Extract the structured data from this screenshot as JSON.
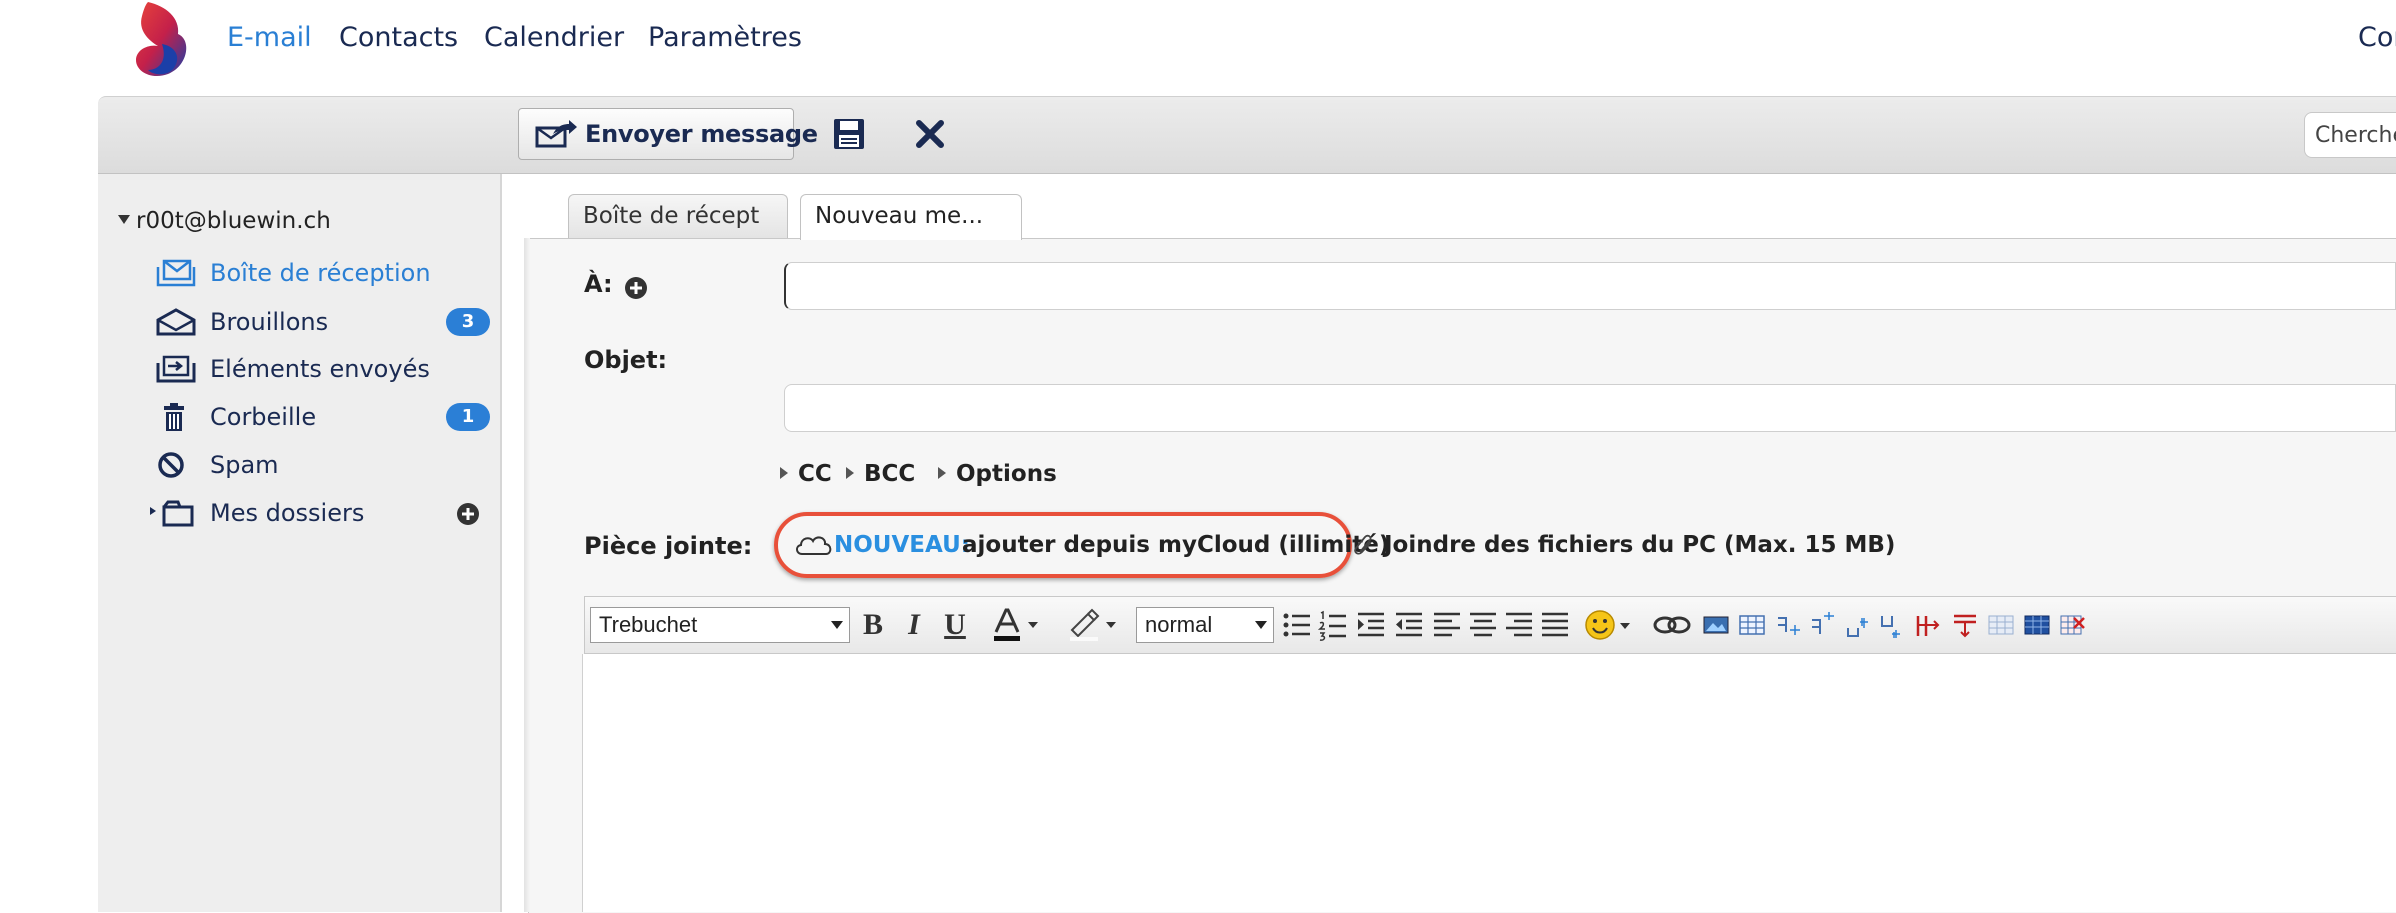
{
  "nav": {
    "email": "E-mail",
    "contacts": "Contacts",
    "calendar": "Calendrier",
    "settings": "Paramètres",
    "right_text": "Cor"
  },
  "toolbar": {
    "send_label": "Envoyer message",
    "search_placeholder": "Cherche"
  },
  "sidebar": {
    "account": "r00t@bluewin.ch",
    "folders": [
      {
        "label": "Boîte de réception",
        "icon": "inbox-icon",
        "active": true
      },
      {
        "label": "Brouillons",
        "icon": "drafts-icon",
        "count": "3"
      },
      {
        "label": "Eléments envoyés",
        "icon": "sent-icon"
      },
      {
        "label": "Corbeille",
        "icon": "trash-icon",
        "count": "1"
      },
      {
        "label": "Spam",
        "icon": "spam-icon"
      },
      {
        "label": "Mes dossiers",
        "icon": "folder-icon"
      }
    ]
  },
  "tabs": [
    {
      "label": "Boîte de récept"
    },
    {
      "label": "Nouveau me..."
    }
  ],
  "compose": {
    "to_label": "À:",
    "subject_label": "Objet:",
    "to_value": "",
    "subject_value": "",
    "cc_label": "CC",
    "bcc_label": "BCC",
    "options_label": "Options",
    "attachment_label": "Pièce jointe:",
    "mycloud_new": "NOUVEAU:",
    "mycloud_text": "ajouter depuis myCloud (illimité)",
    "pc_text": "Joindre des fichiers du PC (Max. 15 MB)"
  },
  "editor": {
    "font": "Trebuchet",
    "size": "normal"
  },
  "colors": {
    "accent": "#2a7fd4",
    "badge": "#2b7fd6",
    "highlight": "#e8503a",
    "new_label": "#2a8fe0"
  }
}
